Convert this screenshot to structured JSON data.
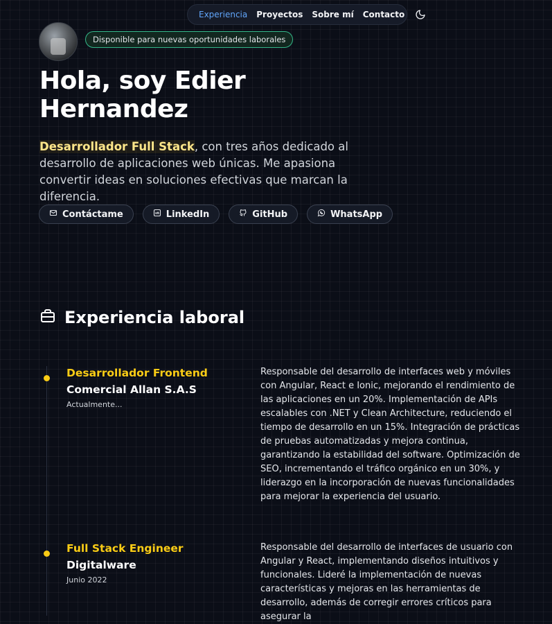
{
  "nav": {
    "items": [
      "Experiencia",
      "Proyectos",
      "Sobre mí",
      "Contacto"
    ],
    "active": "Experiencia",
    "theme_icon": "moon-icon"
  },
  "hero": {
    "badge": "Disponible para nuevas oportunidades laborales",
    "title_line1": "Hola, soy Edier",
    "title_line2": "Hernandez",
    "intro_highlight": "Desarrollador Full Stack",
    "intro_rest": ", con tres años dedicado al desarrollo de aplicaciones web únicas. Me apasiona convertir ideas en soluciones efectivas que marcan la diferencia."
  },
  "buttons": [
    {
      "label": "Contáctame",
      "icon": "mail-icon"
    },
    {
      "label": "LinkedIn",
      "icon": "linkedin-icon"
    },
    {
      "label": "GitHub",
      "icon": "github-icon"
    },
    {
      "label": "WhatsApp",
      "icon": "whatsapp-icon"
    }
  ],
  "experience": {
    "title": "Experiencia laboral",
    "icon": "briefcase-icon",
    "jobs": [
      {
        "role": "Desarrollador Frontend",
        "company": "Comercial Allan S.A.S",
        "date": "Actualmente...",
        "description": "Responsable del desarrollo de interfaces web y móviles con Angular, React e Ionic, mejorando el rendimiento de las aplicaciones en un 20%. Implementación de APIs escalables con .NET y Clean Architecture, reduciendo el tiempo de desarrollo en un 15%. Integración de prácticas de pruebas automatizadas y mejora continua, garantizando la estabilidad del software. Optimización de SEO, incrementando el tráfico orgánico en un 30%, y liderazgo en la incorporación de nuevas funcionalidades para mejorar la experiencia del usuario."
      },
      {
        "role": "Full Stack Engineer",
        "company": "Digitalware",
        "date": "Junio 2022",
        "description": "Responsable del desarrollo de interfaces de usuario con Angular y React, implementando diseños intuitivos y funcionales. Lideré la implementación de nuevas características y mejoras en las herramientas de desarrollo, además de corregir errores críticos para asegurar la"
      }
    ]
  },
  "colors": {
    "accent_yellow": "#facc15",
    "nav_active": "#60a5fa",
    "badge_border": "#34b88a",
    "background": "#0b0e17"
  }
}
